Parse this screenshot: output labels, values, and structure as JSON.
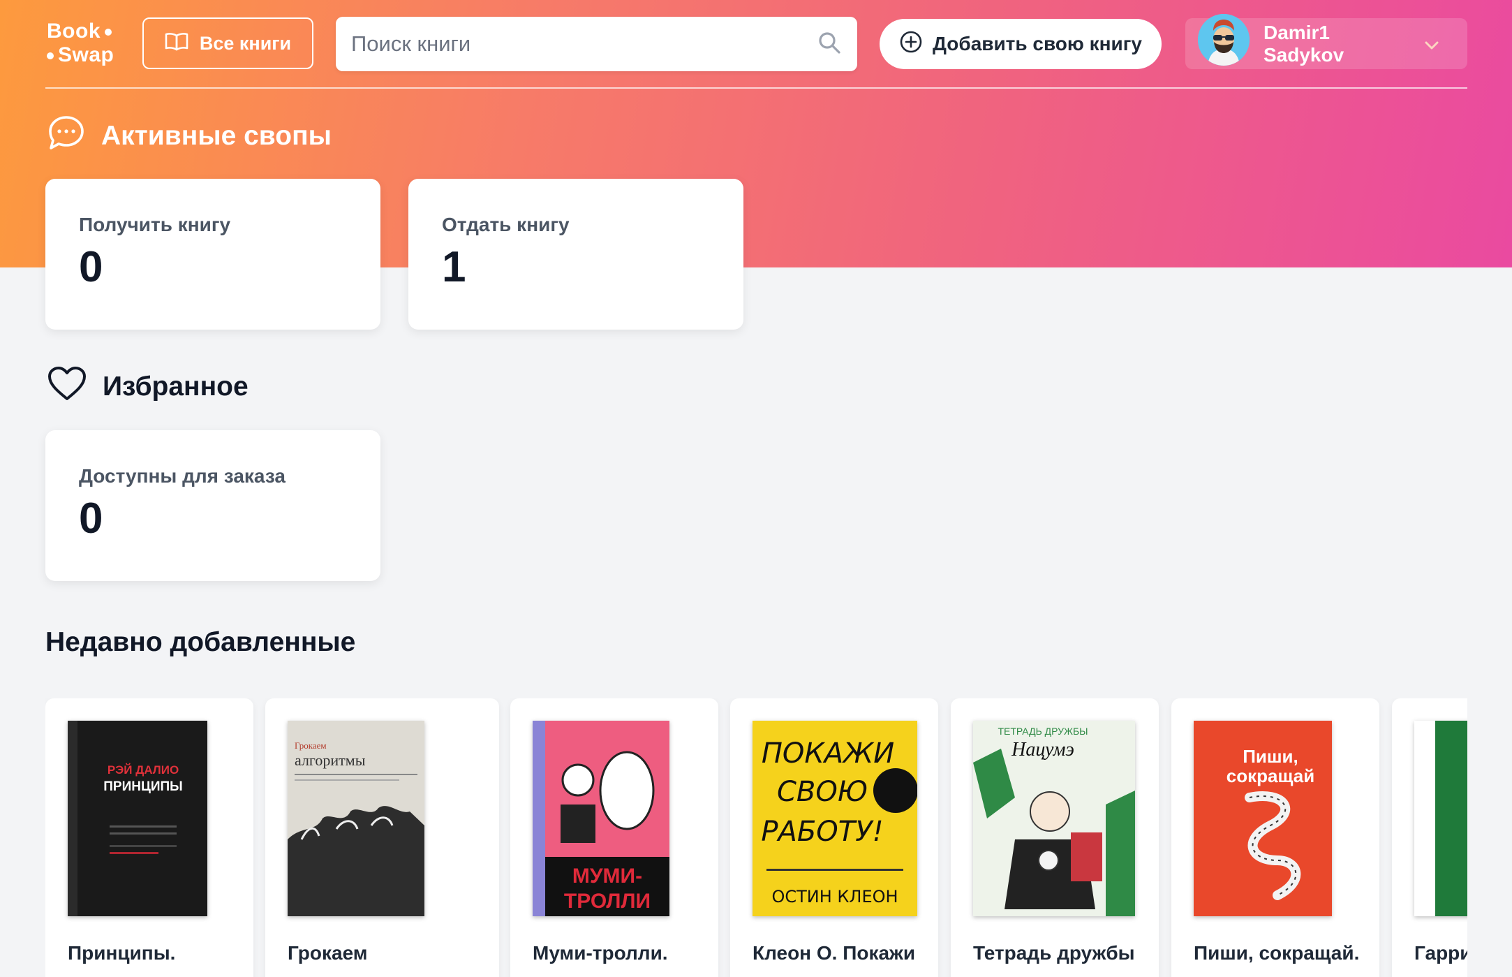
{
  "header": {
    "logo_line1": "Book",
    "logo_line2": "Swap",
    "all_books_label": "Все книги",
    "search_placeholder": "Поиск книги",
    "add_book_label": "Добавить свою книгу",
    "user_name": "Damir1 Sadykov"
  },
  "active_swaps": {
    "title": "Активные свопы",
    "cards": [
      {
        "label": "Получить книгу",
        "value": "0"
      },
      {
        "label": "Отдать книгу",
        "value": "1"
      }
    ]
  },
  "favorites": {
    "title": "Избранное",
    "cards": [
      {
        "label": "Доступны для заказа",
        "value": "0"
      }
    ]
  },
  "recent": {
    "title": "Недавно добавленные",
    "books": [
      {
        "title": "Принципы.",
        "cover_text": "РЭЙ ДАЛИО ПРИНЦИПЫ",
        "cover_color": "#1c1c1c"
      },
      {
        "title": "Грокаем",
        "cover_text": "Грокаем алгоритмы",
        "cover_color": "#d9d6cf"
      },
      {
        "title": "Муми-тролли.",
        "cover_text": "МУМИ-ТРОЛЛИ",
        "cover_color": "#ef5a7b"
      },
      {
        "title": "Клеон О. Покажи",
        "cover_text": "ПОКАЖИ СВОЮ РАБОТУ! ОСТИН КЛЕОН",
        "cover_color": "#f6d31a"
      },
      {
        "title": "Тетрадь дружбы",
        "cover_text": "ТЕТРАДЬ ДРУЖБЫ Нацумэ",
        "cover_color": "#e8f0e4"
      },
      {
        "title": "Пиши, сокращай.",
        "cover_text": "Пиши, сокращай",
        "cover_color": "#e9482b"
      },
      {
        "title": "Гарри",
        "cover_text": "",
        "cover_color": "#1f7a3a"
      }
    ]
  },
  "colors": {
    "gradient_start": "#fd9a3e",
    "gradient_end": "#ea4aa0",
    "page_background": "#f3f4f6"
  }
}
